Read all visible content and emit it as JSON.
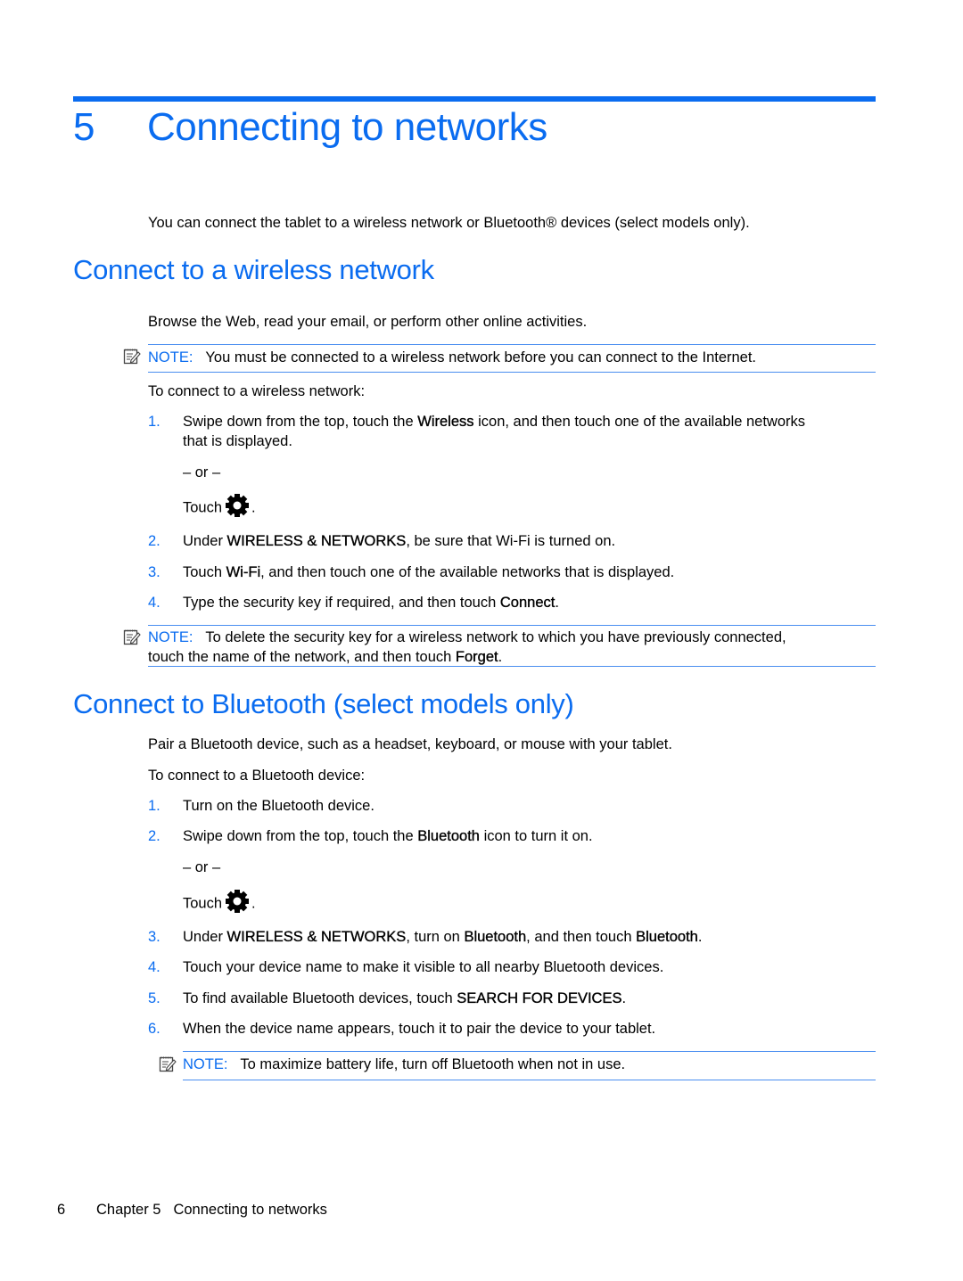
{
  "chapter": {
    "number": "5",
    "title": "Connecting to networks",
    "intro": "You can connect the tablet to a wireless network or Bluetooth® devices (select models only)."
  },
  "colors": {
    "accent": "#0a6cf0"
  },
  "sections": [
    {
      "heading": "Connect to a wireless network",
      "intro": "Browse the Web, read your email, or perform other online activities.",
      "note1": {
        "label": "NOTE:",
        "text": "You must be connected to a wireless network before you can connect to the Internet."
      },
      "lead": "To connect to a wireless network:",
      "steps": [
        {
          "num": "1.",
          "pre": "Swipe down from the top, touch the ",
          "bold": "Wireless",
          "post": " icon, and then touch one of the available networks",
          "line2": "that is displayed.",
          "or": "– or –",
          "touch": "Touch",
          "icon": "settings-gear-icon"
        },
        {
          "num": "2.",
          "pre": "Under ",
          "bold": "WIRELESS & NETWORKS",
          "post": ", be sure that Wi-Fi is turned on."
        },
        {
          "num": "3.",
          "pre": "Touch ",
          "bold": "Wi-Fi",
          "post": ", and then touch one of the available networks that is displayed."
        },
        {
          "num": "4.",
          "pre": "Type the security key if required, and then touch ",
          "bold": "Connect",
          "post": "."
        }
      ],
      "note2": {
        "label": "NOTE:",
        "text": "To delete the security key for a wireless network to which you have previously connected,",
        "line2_pre": "touch the name of the network, and then touch ",
        "line2_bold": "Forget",
        "line2_post": "."
      }
    },
    {
      "heading": "Connect to Bluetooth (select models only)",
      "intro": "Pair a Bluetooth device, such as a headset, keyboard, or mouse with your tablet.",
      "lead": "To connect to a Bluetooth device:",
      "steps": [
        {
          "num": "1.",
          "text": "Turn on the Bluetooth device."
        },
        {
          "num": "2.",
          "pre": "Swipe down from the top, touch the ",
          "bold": "Bluetooth",
          "post": " icon to turn it on.",
          "or": "– or –",
          "touch": "Touch",
          "icon": "settings-gear-icon"
        },
        {
          "num": "3.",
          "pre": "Under ",
          "bold": "WIRELESS & NETWORKS",
          "mid": ", turn on ",
          "bold2": "Bluetooth",
          "mid2": ", and then touch ",
          "bold3": "Bluetooth",
          "post": "."
        },
        {
          "num": "4.",
          "text": "Touch your device name to make it visible to all nearby Bluetooth devices."
        },
        {
          "num": "5.",
          "pre": "To find available Bluetooth devices, touch ",
          "bold": "SEARCH FOR DEVICES",
          "post": "."
        },
        {
          "num": "6.",
          "text": "When the device name appears, touch it to pair the device to your tablet."
        }
      ],
      "note": {
        "label": "NOTE:",
        "text": "To maximize battery life, turn off Bluetooth when not in use."
      }
    }
  ],
  "footer": {
    "page": "6",
    "chapter": "Chapter 5",
    "title": "Connecting to networks"
  }
}
